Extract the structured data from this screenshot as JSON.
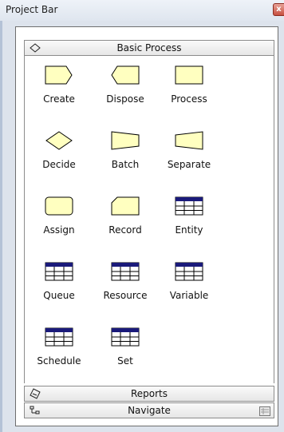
{
  "window": {
    "title": "Project Bar",
    "close_glyph": "x"
  },
  "panels": [
    {
      "label": "Basic Process",
      "icon": "diamond-outline-icon",
      "expanded": true
    },
    {
      "label": "Reports",
      "icon": "reports-icon",
      "expanded": false
    },
    {
      "label": "Navigate",
      "icon": "navigate-icon",
      "expanded": false
    }
  ],
  "modules": [
    {
      "label": "Create",
      "icon": "create-shape-icon"
    },
    {
      "label": "Dispose",
      "icon": "dispose-shape-icon"
    },
    {
      "label": "Process",
      "icon": "process-shape-icon"
    },
    {
      "label": "Decide",
      "icon": "decide-diamond-icon"
    },
    {
      "label": "Batch",
      "icon": "batch-shape-icon"
    },
    {
      "label": "Separate",
      "icon": "separate-shape-icon"
    },
    {
      "label": "Assign",
      "icon": "assign-shape-icon"
    },
    {
      "label": "Record",
      "icon": "record-shape-icon"
    },
    {
      "label": "Entity",
      "icon": "table-icon"
    },
    {
      "label": "Queue",
      "icon": "table-icon"
    },
    {
      "label": "Resource",
      "icon": "table-icon"
    },
    {
      "label": "Variable",
      "icon": "table-icon"
    },
    {
      "label": "Schedule",
      "icon": "table-icon"
    },
    {
      "label": "Set",
      "icon": "table-icon"
    }
  ],
  "colors": {
    "shape_fill": "#ffffc0",
    "shape_stroke": "#000000",
    "table_header": "#1a1a7a",
    "table_fill": "#ffffff"
  }
}
